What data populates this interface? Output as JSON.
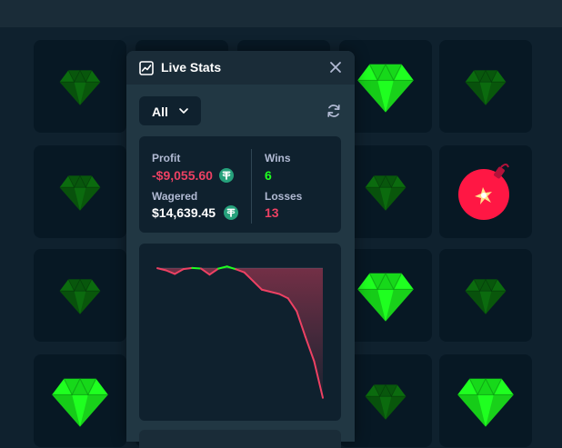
{
  "board": {
    "tiles": [
      {
        "kind": "gem-dim"
      },
      {
        "kind": "gem-dim"
      },
      {
        "kind": "gem-dim"
      },
      {
        "kind": "gem"
      },
      {
        "kind": "gem-dim"
      },
      {
        "kind": "gem-dim"
      },
      {
        "kind": "gem-dim"
      },
      {
        "kind": "gem-dim"
      },
      {
        "kind": "gem-dim"
      },
      {
        "kind": "mine"
      },
      {
        "kind": "gem-dim"
      },
      {
        "kind": "gem-dim"
      },
      {
        "kind": "gem-dim"
      },
      {
        "kind": "gem"
      },
      {
        "kind": "gem-dim"
      },
      {
        "kind": "gem"
      },
      {
        "kind": "gem-dim"
      },
      {
        "kind": "gem-dim"
      },
      {
        "kind": "gem-dim"
      },
      {
        "kind": "gem"
      }
    ]
  },
  "live_stats": {
    "title": "Live Stats",
    "title_icon": "trending-chart-icon",
    "filter": {
      "selected": "All"
    },
    "stats": {
      "profit_label": "Profit",
      "profit_value": "-$9,055.60",
      "wagered_label": "Wagered",
      "wagered_value": "$14,639.45",
      "wins_label": "Wins",
      "wins_value": "6",
      "losses_label": "Losses",
      "losses_value": "13",
      "currency_icon": "tether-coin-icon"
    },
    "chart_data": {
      "type": "line",
      "title": "",
      "xlabel": "",
      "ylabel": "",
      "x": [
        1,
        2,
        3,
        4,
        5,
        6,
        7,
        8,
        9,
        10,
        11,
        12,
        13,
        14,
        15,
        16,
        17,
        18,
        19,
        20
      ],
      "values": [
        0,
        -150,
        -400,
        -60,
        20,
        -20,
        -450,
        -30,
        120,
        -70,
        -300,
        -900,
        -1500,
        -1650,
        -1800,
        -2100,
        -3000,
        -4800,
        -6500,
        -9056
      ],
      "ylim": [
        -9200,
        200
      ],
      "baseline": 0,
      "colors": {
        "positive": "#1fff20",
        "negative": "#ed4163"
      },
      "grid": false
    }
  },
  "colors": {
    "profit_negative": "#ed4163",
    "wins": "#1fff20",
    "losses": "#ed4163",
    "gem_bright": "#1fff20",
    "gem_dim": "#0b6b0e",
    "mine": "#ff1744"
  }
}
